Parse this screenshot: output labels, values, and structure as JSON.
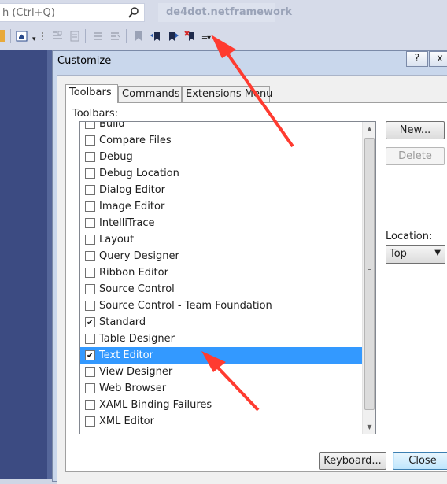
{
  "vs": {
    "search_placeholder": "h (Ctrl+Q)",
    "window_title": "de4dot.netframework",
    "accent_bg": "#3c4b82"
  },
  "dialog": {
    "title": "Customize",
    "help_label": "?",
    "close_glyph": "x",
    "tabs": [
      {
        "label": "Toolbars",
        "active": true
      },
      {
        "label": "Commands",
        "active": false
      },
      {
        "label": "Extensions Menu",
        "active": false
      }
    ],
    "toolbars_label": "Toolbars:",
    "toolbar_items": [
      {
        "label": "Build",
        "checked": false,
        "selected": false
      },
      {
        "label": "Compare Files",
        "checked": false,
        "selected": false
      },
      {
        "label": "Debug",
        "checked": false,
        "selected": false
      },
      {
        "label": "Debug Location",
        "checked": false,
        "selected": false
      },
      {
        "label": "Dialog Editor",
        "checked": false,
        "selected": false
      },
      {
        "label": "Image Editor",
        "checked": false,
        "selected": false
      },
      {
        "label": "IntelliTrace",
        "checked": false,
        "selected": false
      },
      {
        "label": "Layout",
        "checked": false,
        "selected": false
      },
      {
        "label": "Query Designer",
        "checked": false,
        "selected": false
      },
      {
        "label": "Ribbon Editor",
        "checked": false,
        "selected": false
      },
      {
        "label": "Source Control",
        "checked": false,
        "selected": false
      },
      {
        "label": "Source Control - Team Foundation",
        "checked": false,
        "selected": false
      },
      {
        "label": "Standard",
        "checked": true,
        "selected": false
      },
      {
        "label": "Table Designer",
        "checked": false,
        "selected": false
      },
      {
        "label": "Text Editor",
        "checked": true,
        "selected": true
      },
      {
        "label": "View Designer",
        "checked": false,
        "selected": false
      },
      {
        "label": "Web Browser",
        "checked": false,
        "selected": false
      },
      {
        "label": "XAML Binding Failures",
        "checked": false,
        "selected": false
      },
      {
        "label": "XML Editor",
        "checked": false,
        "selected": false
      }
    ],
    "new_button": "New...",
    "delete_button": "Delete",
    "location_label": "Location:",
    "location_value": "Top",
    "keyboard_button": "Keyboard...",
    "close_button": "Close",
    "selection_color": "#3399ff",
    "annotation_color": "#ff3b30"
  }
}
